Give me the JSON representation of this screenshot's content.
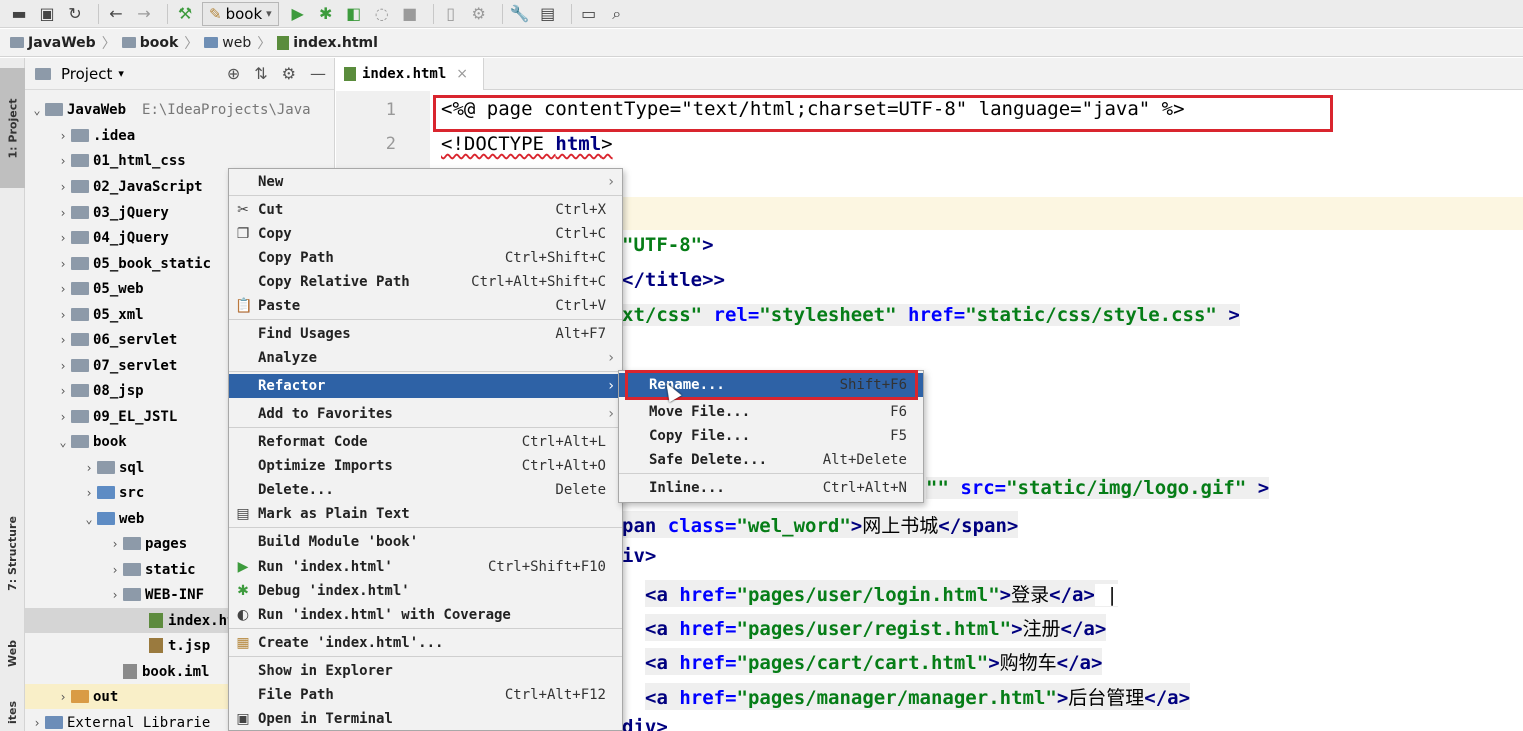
{
  "toolbar": {
    "run_config": "book",
    "icons": [
      "open-folder-icon",
      "save-icon",
      "sync-icon",
      "back-icon",
      "forward-icon",
      "build-hammer-icon",
      "run-config-icon",
      "run-icon",
      "debug-icon",
      "coverage-icon",
      "profile-icon",
      "stop-icon",
      "device-icon",
      "attach-icon",
      "wrench-icon",
      "project-structure-icon",
      "terminal-icon",
      "search-icon"
    ]
  },
  "breadcrumb": [
    "JavaWeb",
    "book",
    "web",
    "index.html"
  ],
  "left_strip": {
    "project_tab": "1: Project",
    "structure_tab": "7: Structure",
    "web_tab": "Web",
    "favorites_tab": "ites"
  },
  "project_panel": {
    "title": "Project",
    "tree": [
      {
        "label": "JavaWeb",
        "path": "E:\\IdeaProjects\\Java",
        "level": 0,
        "expanded": true,
        "kind": "module"
      },
      {
        "label": ".idea",
        "level": 1,
        "kind": "folder"
      },
      {
        "label": "01_html_css",
        "level": 1,
        "kind": "module"
      },
      {
        "label": "02_JavaScript",
        "level": 1,
        "kind": "module"
      },
      {
        "label": "03_jQuery",
        "level": 1,
        "kind": "module"
      },
      {
        "label": "04_jQuery",
        "level": 1,
        "kind": "module"
      },
      {
        "label": "05_book_static",
        "level": 1,
        "kind": "module"
      },
      {
        "label": "05_web",
        "level": 1,
        "kind": "module"
      },
      {
        "label": "05_xml",
        "level": 1,
        "kind": "module"
      },
      {
        "label": "06_servlet",
        "level": 1,
        "kind": "module"
      },
      {
        "label": "07_servlet",
        "level": 1,
        "kind": "module"
      },
      {
        "label": "08_jsp",
        "level": 1,
        "kind": "module"
      },
      {
        "label": "09_EL_JSTL",
        "level": 1,
        "kind": "module"
      },
      {
        "label": "book",
        "level": 1,
        "expanded": true,
        "kind": "module"
      },
      {
        "label": "sql",
        "level": 2,
        "kind": "folder"
      },
      {
        "label": "src",
        "level": 2,
        "kind": "source"
      },
      {
        "label": "web",
        "level": 2,
        "expanded": true,
        "kind": "web"
      },
      {
        "label": "pages",
        "level": 3,
        "kind": "folder"
      },
      {
        "label": "static",
        "level": 3,
        "kind": "folder"
      },
      {
        "label": "WEB-INF",
        "level": 3,
        "kind": "folder"
      },
      {
        "label": "index.htr",
        "level": 4,
        "kind": "html",
        "selected": true
      },
      {
        "label": "t.jsp",
        "level": 4,
        "kind": "jsp"
      },
      {
        "label": "book.iml",
        "level": 3,
        "kind": "iml"
      },
      {
        "label": "out",
        "level": 1,
        "kind": "out"
      },
      {
        "label": "External Librarie",
        "level": 0,
        "kind": "lib"
      }
    ]
  },
  "editor": {
    "tab_label": "index.html",
    "line_numbers": [
      "1",
      "2"
    ],
    "line1": {
      "a": "<%@ page contentType=",
      "b": "\"text/html;charset=UTF-8\"",
      "c": " language=",
      "d": "\"java\"",
      "e": " %>"
    },
    "line2": {
      "a": "<!DOCTYPE ",
      "b": "html",
      "c": ">"
    },
    "charset_frag": {
      "a": "\"UTF-8\"",
      "b": ">"
    },
    "title_frag": {
      "a": "</title>",
      "b": ">"
    },
    "css_frag": {
      "a": "xt/css\"",
      "b": " rel=",
      "c": "\"stylesheet\"",
      "d": " href=",
      "e": "\"static/css/style.css\"",
      "f": " >"
    },
    "img_frag": {
      "a": "\"\"",
      "b": " src=",
      "c": "\"static/img/logo.gif\"",
      "d": " >"
    },
    "span_frag": {
      "a": "pan",
      "b": " class=",
      "c": "\"wel_word\"",
      "d": ">",
      "e": "网上书城",
      "f": "</span>"
    },
    "div_frag": "iv>",
    "links": [
      {
        "href": "\"pages/user/login.html\"",
        "text": "登录",
        "suffix": " |"
      },
      {
        "href": "\"pages/user/regist.html\"",
        "text": "注册",
        "suffix": ""
      },
      {
        "href": "\"pages/cart/cart.html\"",
        "text": "购物车",
        "suffix": ""
      },
      {
        "href": "\"pages/manager/manager.html\"",
        "text": "后台管理",
        "suffix": ""
      }
    ],
    "link_tokens": {
      "open": "<a",
      "attr": " href=",
      "gt": ">",
      "close": "</a>"
    },
    "last_frag": "div>"
  },
  "context_menu": {
    "items": [
      {
        "label": "New",
        "shortcut": "",
        "submenu": true,
        "icon": ""
      },
      {
        "label": "Cut",
        "shortcut": "Ctrl+X",
        "icon": "cut-icon",
        "glyph": "✂"
      },
      {
        "label": "Copy",
        "shortcut": "Ctrl+C",
        "icon": "copy-icon",
        "glyph": "❐"
      },
      {
        "label": "Copy Path",
        "shortcut": "Ctrl+Shift+C",
        "icon": ""
      },
      {
        "label": "Copy Relative Path",
        "shortcut": "Ctrl+Alt+Shift+C",
        "icon": ""
      },
      {
        "label": "Paste",
        "shortcut": "Ctrl+V",
        "icon": "paste-icon",
        "glyph": "📋"
      },
      {
        "label": "Find Usages",
        "shortcut": "Alt+F7",
        "icon": ""
      },
      {
        "label": "Analyze",
        "shortcut": "",
        "submenu": true,
        "icon": ""
      },
      {
        "label": "Refactor",
        "shortcut": "",
        "submenu": true,
        "active": true,
        "icon": ""
      },
      {
        "label": "Add to Favorites",
        "shortcut": "",
        "submenu": true,
        "icon": ""
      },
      {
        "label": "Reformat Code",
        "shortcut": "Ctrl+Alt+L",
        "icon": ""
      },
      {
        "label": "Optimize Imports",
        "shortcut": "Ctrl+Alt+O",
        "icon": ""
      },
      {
        "label": "Delete...",
        "shortcut": "Delete",
        "icon": ""
      },
      {
        "label": "Mark as Plain Text",
        "shortcut": "",
        "icon": "plain-text-icon",
        "glyph": "▤"
      },
      {
        "label": "Build Module 'book'",
        "shortcut": "",
        "icon": ""
      },
      {
        "label": "Run 'index.html'",
        "shortcut": "Ctrl+Shift+F10",
        "icon": "run-icon",
        "glyph": "▶"
      },
      {
        "label": "Debug 'index.html'",
        "shortcut": "",
        "icon": "debug-icon",
        "glyph": "✱"
      },
      {
        "label": "Run 'index.html' with Coverage",
        "shortcut": "",
        "icon": "coverage-icon",
        "glyph": "◐"
      },
      {
        "label": "Create 'index.html'...",
        "shortcut": "",
        "icon": "create-config-icon",
        "glyph": "▦"
      },
      {
        "label": "Show in Explorer",
        "shortcut": "",
        "icon": ""
      },
      {
        "label": "File Path",
        "shortcut": "Ctrl+Alt+F12",
        "icon": ""
      },
      {
        "label": "Open in Terminal",
        "shortcut": "",
        "icon": "terminal-icon",
        "glyph": "▣"
      }
    ]
  },
  "refactor_submenu": {
    "items": [
      {
        "label": "Rename...",
        "shortcut": "Shift+F6",
        "active": true
      },
      {
        "label": "Move File...",
        "shortcut": "F6"
      },
      {
        "label": "Copy File...",
        "shortcut": "F5"
      },
      {
        "label": "Safe Delete...",
        "shortcut": "Alt+Delete"
      },
      {
        "label": "Inline...",
        "shortcut": "Ctrl+Alt+N"
      }
    ]
  },
  "colors": {
    "highlight_red": "#d9252e",
    "menu_active": "#2e62a6",
    "tag": "#00007f",
    "attr": "#0000ff",
    "string": "#067d17"
  }
}
